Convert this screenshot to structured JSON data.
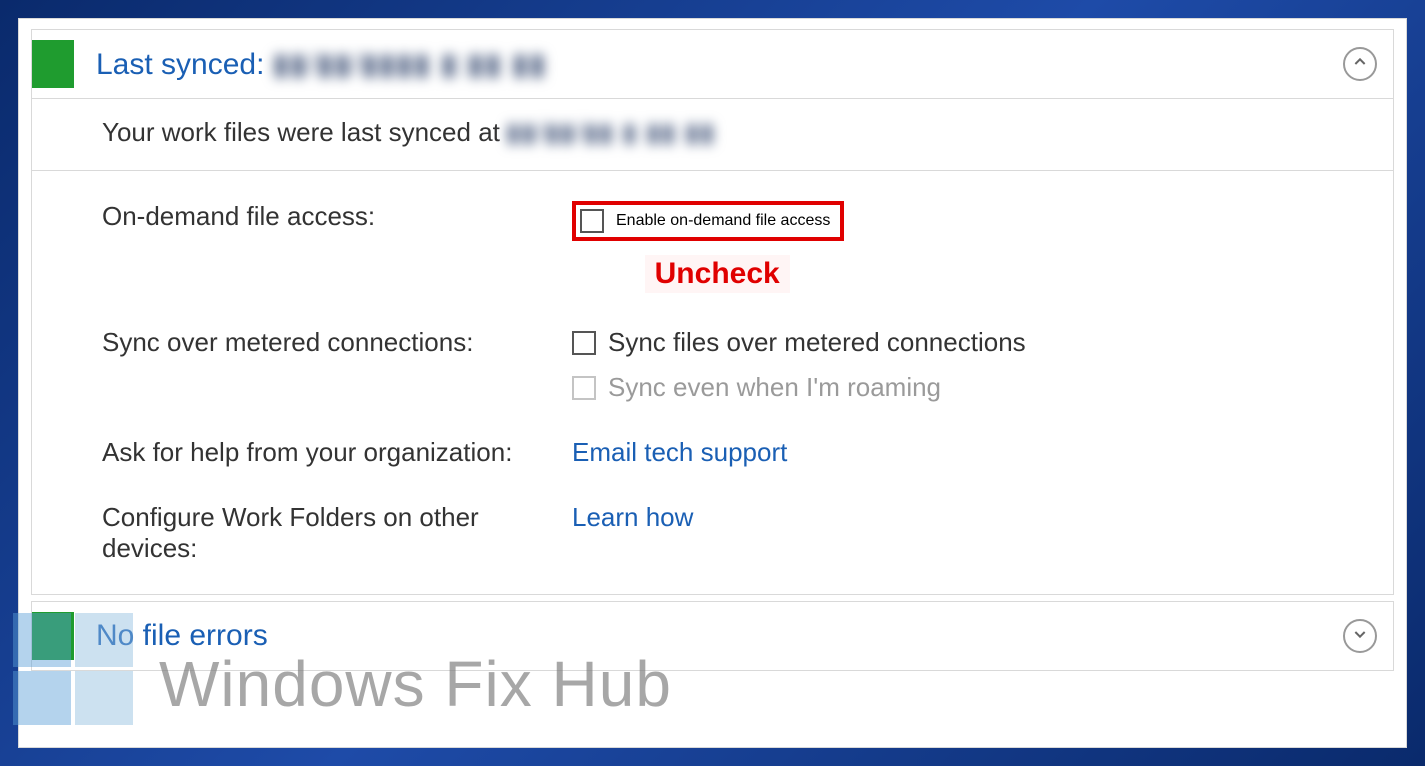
{
  "header": {
    "title_prefix": "Last synced:",
    "title_value_obscured": "▮▮/▮▮/▮▮▮▮ ▮:▮▮ ▮▮"
  },
  "sync_status": {
    "text": "Your work files were last synced at",
    "value_obscured": "▮▮/▮▮/▮▮ ▮ ▮▮ ▮▮"
  },
  "settings": {
    "on_demand": {
      "label": "On-demand file access:",
      "checkbox_label": "Enable on-demand file access"
    },
    "metered": {
      "label": "Sync over metered connections:",
      "checkbox1_label": "Sync files over metered connections",
      "checkbox2_label": "Sync even when I'm roaming"
    },
    "help": {
      "label": "Ask for help from your organization:",
      "link": "Email tech support"
    },
    "configure": {
      "label": "Configure Work Folders on other devices:",
      "link": "Learn how"
    }
  },
  "errors_header": {
    "title": "No file errors"
  },
  "annotation": {
    "text": "Uncheck"
  },
  "watermark": "Windows Fix Hub"
}
